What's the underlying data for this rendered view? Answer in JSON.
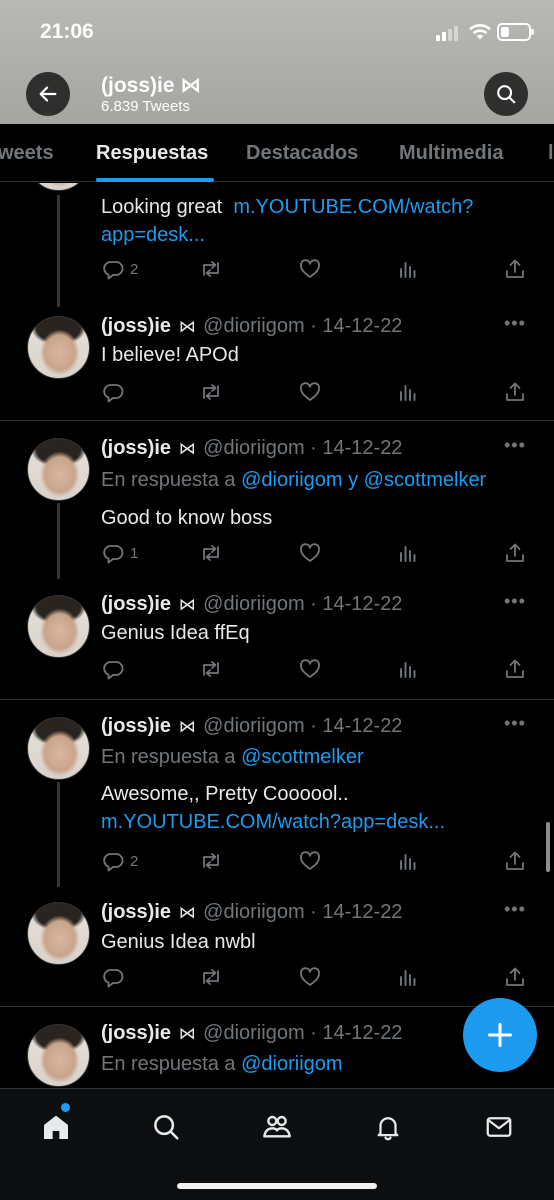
{
  "status_bar": {
    "time": "21:06"
  },
  "header": {
    "name": "(joss)ie ⋈",
    "tweet_count": "6.839 Tweets"
  },
  "tabs": [
    {
      "label": "Tweets",
      "visible": "weets"
    },
    {
      "label": "Respuestas",
      "visible": "Respuestas"
    },
    {
      "label": "Destacados",
      "visible": "Destacados"
    },
    {
      "label": "Multimedia",
      "visible": "Multimedia"
    }
  ],
  "tweets": [
    {
      "text": "Looking great",
      "link_line1": "m.YOUTUBE.COM/watch?",
      "link_line2": "app=desk...",
      "replies": "2"
    },
    {
      "name": "(joss)ie",
      "bowtie": "⋈",
      "handle": "@dioriigom · 14-12-22",
      "text": "I believe! APOd"
    },
    {
      "name": "(joss)ie",
      "bowtie": "⋈",
      "handle": "@dioriigom · 14-12-22",
      "reply_prefix": "En respuesta a",
      "reply_mention1": "@dioriigom",
      "reply_joiner": "y",
      "reply_mention2": "@scottmelker",
      "text": "Good to know boss",
      "replies": "1"
    },
    {
      "name": "(joss)ie",
      "bowtie": "⋈",
      "handle": "@dioriigom · 14-12-22",
      "text": "Genius Idea ffEq"
    },
    {
      "name": "(joss)ie",
      "bowtie": "⋈",
      "handle": "@dioriigom · 14-12-22",
      "reply_prefix": "En respuesta a",
      "reply_mention1": "@scottmelker",
      "text": "Awesome,, Pretty Coooool..",
      "link": "m.YOUTUBE.COM/watch?app=desk...",
      "replies": "2"
    },
    {
      "name": "(joss)ie",
      "bowtie": "⋈",
      "handle": "@dioriigom · 14-12-22",
      "text": "Genius Idea nwbl"
    },
    {
      "name": "(joss)ie",
      "bowtie": "⋈",
      "handle": "@dioriigom · 14-12-22",
      "reply_prefix": "En respuesta a",
      "reply_mention1": "@dioriigom"
    }
  ],
  "icons": {
    "back": "arrow-left-icon",
    "search": "search-icon",
    "more": "more-icon",
    "reply": "reply-icon",
    "retweet": "retweet-icon",
    "like": "heart-icon",
    "views": "views-icon",
    "share": "share-icon",
    "compose": "plus-icon",
    "nav": [
      "home-icon",
      "search-icon",
      "communities-icon",
      "notifications-icon",
      "messages-icon"
    ]
  },
  "colors": {
    "accent": "#1d9bf0",
    "background": "#000000",
    "muted": "#71767b",
    "text": "#e7e9ea"
  }
}
